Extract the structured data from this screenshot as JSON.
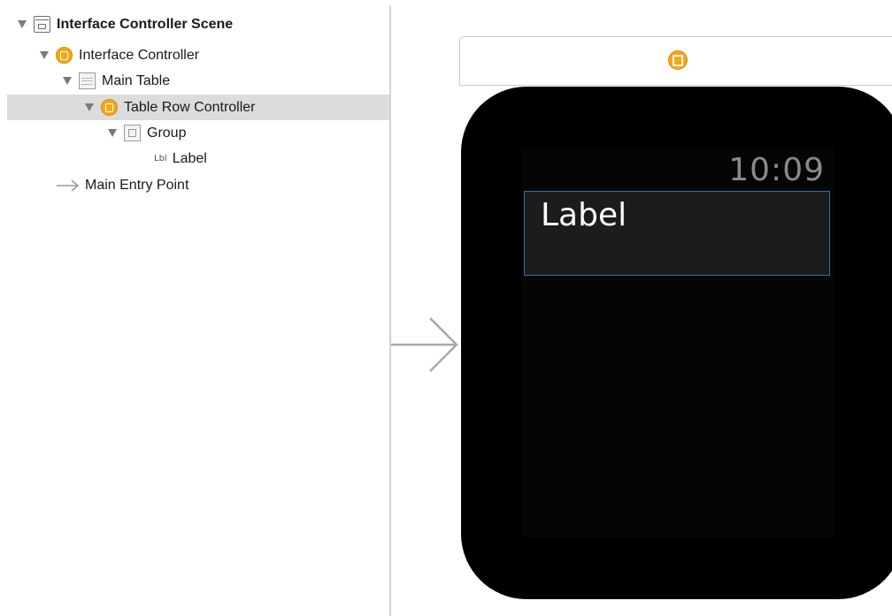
{
  "outline": {
    "scene": {
      "title": "Interface Controller Scene",
      "icon": "storyboard-scene-icon"
    },
    "items": [
      {
        "label": "Interface Controller",
        "icon": "interface-controller-icon"
      },
      {
        "label": "Main Table",
        "icon": "table-icon"
      },
      {
        "label": "Table Row Controller",
        "icon": "row-controller-icon",
        "selected": true
      },
      {
        "label": "Group",
        "icon": "group-icon"
      },
      {
        "tag": "Lbl",
        "label": "Label",
        "icon": "label-icon"
      },
      {
        "label": "Main Entry Point",
        "icon": "entry-arrow-icon"
      }
    ]
  },
  "canvas": {
    "time": "10:09",
    "row_label": "Label"
  },
  "colors": {
    "controller_accent": "#f2a81b",
    "selection_bg": "#dcdcdc",
    "watch_bezel": "#000000",
    "row_border": "#2f6fb0"
  }
}
